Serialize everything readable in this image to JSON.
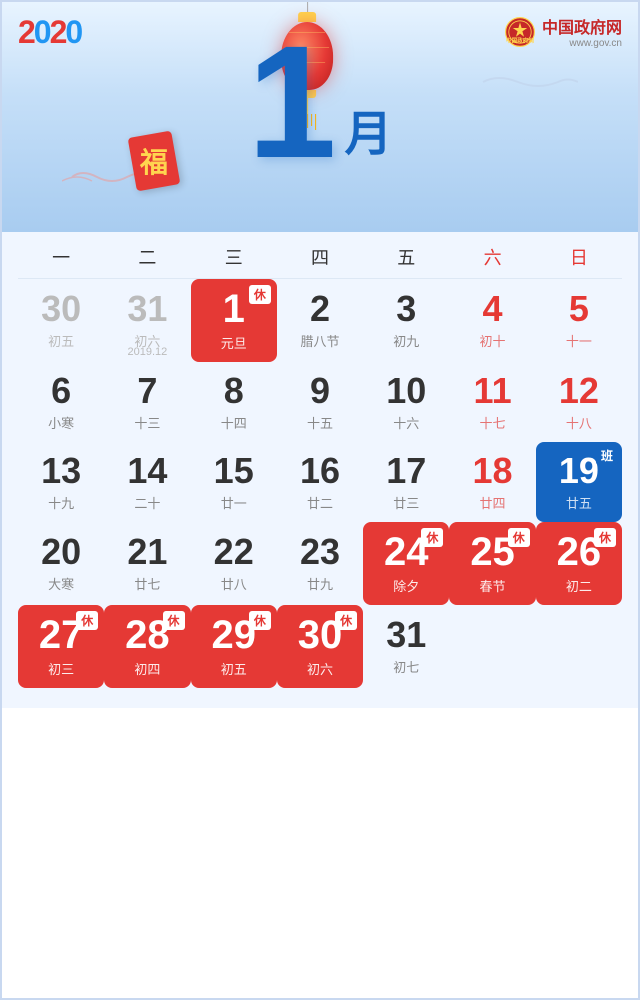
{
  "header": {
    "logo": "2020",
    "gov_name": "中国政府网",
    "gov_url": "www.gov.cn",
    "month_number": "1",
    "month_char": "月"
  },
  "day_headers": [
    {
      "label": "一",
      "weekend": false
    },
    {
      "label": "二",
      "weekend": false
    },
    {
      "label": "三",
      "weekend": false
    },
    {
      "label": "四",
      "weekend": false
    },
    {
      "label": "五",
      "weekend": false
    },
    {
      "label": "六",
      "weekend": true
    },
    {
      "label": "日",
      "weekend": true
    }
  ],
  "weeks": [
    {
      "cells": [
        {
          "num": "30",
          "sub": "初五",
          "type": "prev-month"
        },
        {
          "num": "31",
          "sub": "初六",
          "type": "prev-month"
        },
        {
          "num": "1",
          "sub": "元旦",
          "type": "big-holiday",
          "badge": "休"
        },
        {
          "num": "2",
          "sub": "腊八节",
          "type": "normal"
        },
        {
          "num": "3",
          "sub": "初九",
          "type": "normal"
        },
        {
          "num": "4",
          "sub": "初十",
          "type": "weekend"
        },
        {
          "num": "5",
          "sub": "十一",
          "type": "weekend"
        }
      ]
    },
    {
      "cells": [
        {
          "num": "6",
          "sub": "小寒",
          "type": "normal"
        },
        {
          "num": "7",
          "sub": "十三",
          "type": "normal"
        },
        {
          "num": "8",
          "sub": "十四",
          "type": "normal"
        },
        {
          "num": "9",
          "sub": "十五",
          "type": "normal"
        },
        {
          "num": "10",
          "sub": "十六",
          "type": "normal"
        },
        {
          "num": "11",
          "sub": "十七",
          "type": "weekend"
        },
        {
          "num": "12",
          "sub": "十八",
          "type": "weekend"
        }
      ]
    },
    {
      "cells": [
        {
          "num": "13",
          "sub": "十九",
          "type": "normal"
        },
        {
          "num": "14",
          "sub": "二十",
          "type": "normal"
        },
        {
          "num": "15",
          "sub": "廿一",
          "type": "normal"
        },
        {
          "num": "16",
          "sub": "廿二",
          "type": "normal"
        },
        {
          "num": "17",
          "sub": "廿三",
          "type": "normal"
        },
        {
          "num": "18",
          "sub": "廿四",
          "type": "weekend"
        },
        {
          "num": "19",
          "sub": "廿五",
          "type": "workday",
          "badge": "班"
        }
      ]
    },
    {
      "cells": [
        {
          "num": "20",
          "sub": "大寒",
          "type": "normal"
        },
        {
          "num": "21",
          "sub": "廿七",
          "type": "normal"
        },
        {
          "num": "22",
          "sub": "廿八",
          "type": "normal"
        },
        {
          "num": "23",
          "sub": "廿九",
          "type": "normal"
        },
        {
          "num": "24",
          "sub": "除夕",
          "type": "big-holiday",
          "badge": "休"
        },
        {
          "num": "25",
          "sub": "春节",
          "type": "big-holiday",
          "badge": "休"
        },
        {
          "num": "26",
          "sub": "初二",
          "type": "big-holiday",
          "badge": "休"
        }
      ]
    },
    {
      "cells": [
        {
          "num": "27",
          "sub": "初三",
          "type": "big-holiday",
          "badge": "休"
        },
        {
          "num": "28",
          "sub": "初四",
          "type": "big-holiday",
          "badge": "休"
        },
        {
          "num": "29",
          "sub": "初五",
          "type": "big-holiday",
          "badge": "休"
        },
        {
          "num": "30",
          "sub": "初六",
          "type": "big-holiday",
          "badge": "休"
        },
        {
          "num": "31",
          "sub": "初七",
          "type": "normal"
        },
        {
          "num": "",
          "sub": "",
          "type": "empty"
        },
        {
          "num": "",
          "sub": "",
          "type": "empty"
        }
      ]
    }
  ]
}
